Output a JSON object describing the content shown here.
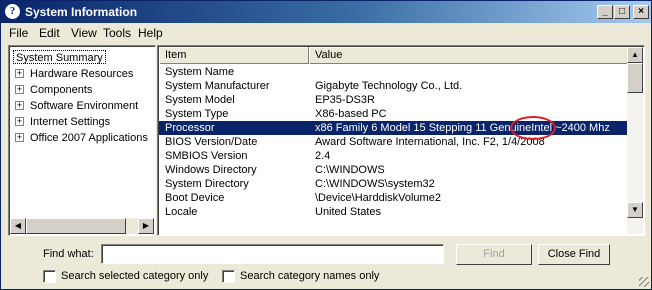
{
  "window": {
    "title": "System Information",
    "icon": "help-question-icon",
    "controls": {
      "minimize": "_",
      "maximize": "□",
      "close": "×"
    }
  },
  "menu": [
    "File",
    "Edit",
    "View",
    "Tools",
    "Help"
  ],
  "tree": {
    "root": "System Summary",
    "nodes": [
      "Hardware Resources",
      "Components",
      "Software Environment",
      "Internet Settings",
      "Office 2007 Applications"
    ],
    "expander": "+"
  },
  "list": {
    "columns": [
      "Item",
      "Value"
    ],
    "rows": [
      {
        "item": "System Name",
        "value": ""
      },
      {
        "item": "System Manufacturer",
        "value": "Gigabyte Technology Co., Ltd."
      },
      {
        "item": "System Model",
        "value": "EP35-DS3R"
      },
      {
        "item": "System Type",
        "value": "X86-based PC"
      },
      {
        "item": "Processor",
        "value": "x86 Family 6 Model 15 Stepping 11 GenuineIntel ~2400 Mhz",
        "selected": true
      },
      {
        "item": "BIOS Version/Date",
        "value": "Award Software International, Inc. F2, 1/4/2008"
      },
      {
        "item": "SMBIOS Version",
        "value": "2.4"
      },
      {
        "item": "Windows Directory",
        "value": "C:\\WINDOWS"
      },
      {
        "item": "System Directory",
        "value": "C:\\WINDOWS\\system32"
      },
      {
        "item": "Boot Device",
        "value": "\\Device\\HarddiskVolume2"
      },
      {
        "item": "Locale",
        "value": "United States"
      }
    ],
    "annotation_color": "#e02020",
    "selection_color": "#0a246a"
  },
  "find": {
    "label": "Find what:",
    "value": "",
    "find_button": "Find",
    "close_button": "Close Find",
    "option1": "Search selected category only",
    "option2": "Search category names only"
  },
  "scroll_glyphs": {
    "up": "▲",
    "down": "▼",
    "left": "◀",
    "right": "▶"
  }
}
